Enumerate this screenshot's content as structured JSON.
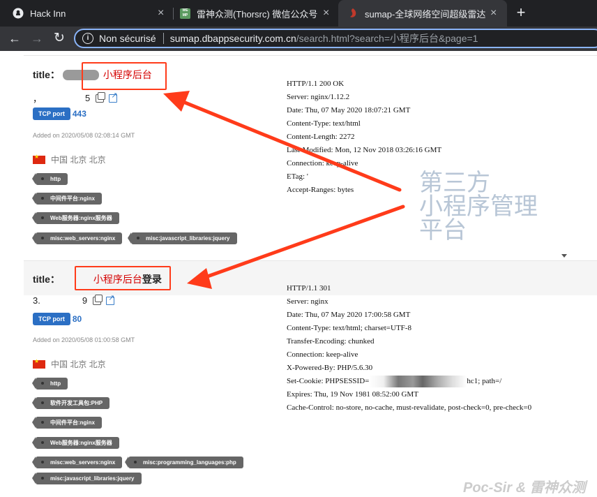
{
  "browser": {
    "tabs": [
      {
        "label": "Hack Inn",
        "icon": "github-icon"
      },
      {
        "label": "雷神众测(Thorsrc) 微信公众号",
        "icon": "wechat-icon",
        "icon_text": "WE MP"
      },
      {
        "label": "sumap-全球网络空间超级雷达",
        "icon": "sumap-icon",
        "active": true
      }
    ],
    "close_glyph": "×",
    "new_tab_glyph": "+",
    "nav": {
      "back": "←",
      "forward": "→",
      "reload": "↻"
    },
    "omnibox": {
      "info_glyph": "i",
      "security_label": "Non sécurisé",
      "host": "sumap.dbappsecurity.com.cn",
      "path": "/search.html?search=小程序后台&page=1"
    }
  },
  "results": [
    {
      "title_label": "title：",
      "title_text": "小程序后台",
      "title_suffix": "",
      "ip_prefix": "，",
      "ip_suffix": "5",
      "port_label": "TCP  port",
      "port": "443",
      "added": "Added on 2020/05/08 02:08:14 GMT",
      "location": "中国 北京 北京",
      "tags": [
        "http",
        "中间件平台:nginx",
        "Web服务器:nginx服务器",
        "misc:web_servers:nginx",
        "misc:javascript_libraries:jquery"
      ],
      "response": [
        "HTTP/1.1 200 OK",
        "Server: nginx/1.12.2",
        "Date: Thu, 07 May 2020 18:07:21 GMT",
        "Content-Type: text/html",
        "Content-Length: 2272",
        "Last-Modified: Mon, 12 Nov 2018 03:26:16 GMT",
        "Connection: keep-alive",
        "ETag: '",
        "Accept-Ranges: bytes"
      ]
    },
    {
      "title_label": "title：",
      "title_text": "小程序后台",
      "title_suffix": "登录",
      "ip_prefix": "3.",
      "ip_suffix": "9",
      "port_label": "TCP  port",
      "port": "80",
      "added": "Added on 2020/05/08 01:00:58 GMT",
      "location": "中国 北京 北京",
      "tags": [
        "http",
        "软件开发工具包:PHP",
        "中间件平台:nginx",
        "Web服务器:nginx服务器",
        "misc:web_servers:nginx",
        "misc:programming_languages:php",
        "misc:javascript_libraries:jquery"
      ],
      "response": [
        "HTTP/1.1 301",
        "Server: nginx",
        "Date: Thu, 07 May 2020 17:00:58 GMT",
        "Content-Type: text/html; charset=UTF-8",
        "Transfer-Encoding: chunked",
        "Connection: keep-alive",
        "X-Powered-By: PHP/5.6.30"
      ],
      "set_cookie_prefix": "Set-Cookie: PHPSESSID=",
      "set_cookie_suffix": "hc1; path=/",
      "response_tail": [
        "Expires: Thu, 19 Nov 1981 08:52:00 GMT",
        "Cache-Control: no-store, no-cache, must-revalidate, post-check=0, pre-check=0"
      ]
    }
  ],
  "annotation": "第三方\n小程序管理\n平台",
  "watermark": "Poc-Sir & 雷神众测",
  "colors": {
    "highlight": "#ff3b1a",
    "annotation": "#b8c6d6",
    "tcp_badge": "#2b6fc4"
  }
}
